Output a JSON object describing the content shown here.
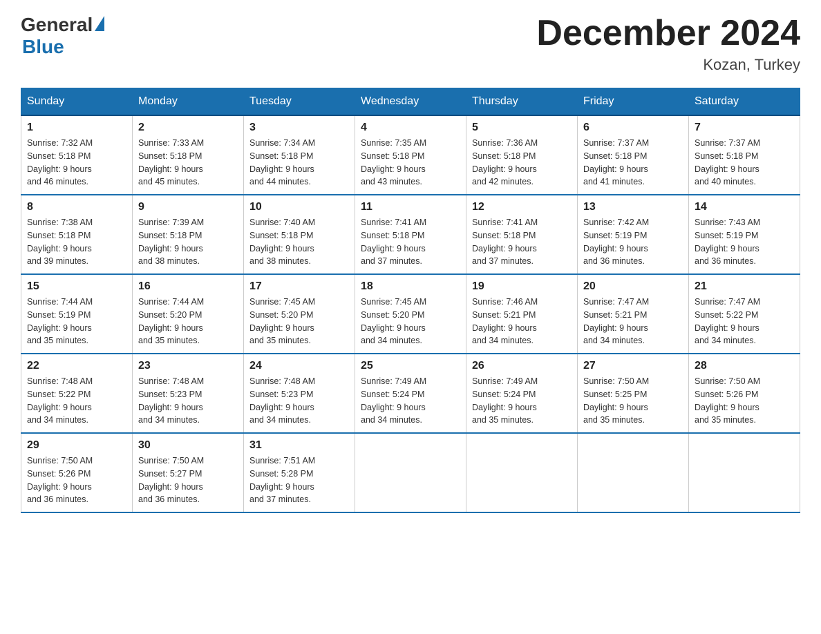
{
  "logo": {
    "general": "General",
    "blue": "Blue"
  },
  "title": {
    "month_year": "December 2024",
    "location": "Kozan, Turkey"
  },
  "days_of_week": [
    "Sunday",
    "Monday",
    "Tuesday",
    "Wednesday",
    "Thursday",
    "Friday",
    "Saturday"
  ],
  "weeks": [
    [
      {
        "day": "1",
        "sunrise": "7:32 AM",
        "sunset": "5:18 PM",
        "daylight": "9 hours and 46 minutes."
      },
      {
        "day": "2",
        "sunrise": "7:33 AM",
        "sunset": "5:18 PM",
        "daylight": "9 hours and 45 minutes."
      },
      {
        "day": "3",
        "sunrise": "7:34 AM",
        "sunset": "5:18 PM",
        "daylight": "9 hours and 44 minutes."
      },
      {
        "day": "4",
        "sunrise": "7:35 AM",
        "sunset": "5:18 PM",
        "daylight": "9 hours and 43 minutes."
      },
      {
        "day": "5",
        "sunrise": "7:36 AM",
        "sunset": "5:18 PM",
        "daylight": "9 hours and 42 minutes."
      },
      {
        "day": "6",
        "sunrise": "7:37 AM",
        "sunset": "5:18 PM",
        "daylight": "9 hours and 41 minutes."
      },
      {
        "day": "7",
        "sunrise": "7:37 AM",
        "sunset": "5:18 PM",
        "daylight": "9 hours and 40 minutes."
      }
    ],
    [
      {
        "day": "8",
        "sunrise": "7:38 AM",
        "sunset": "5:18 PM",
        "daylight": "9 hours and 39 minutes."
      },
      {
        "day": "9",
        "sunrise": "7:39 AM",
        "sunset": "5:18 PM",
        "daylight": "9 hours and 38 minutes."
      },
      {
        "day": "10",
        "sunrise": "7:40 AM",
        "sunset": "5:18 PM",
        "daylight": "9 hours and 38 minutes."
      },
      {
        "day": "11",
        "sunrise": "7:41 AM",
        "sunset": "5:18 PM",
        "daylight": "9 hours and 37 minutes."
      },
      {
        "day": "12",
        "sunrise": "7:41 AM",
        "sunset": "5:18 PM",
        "daylight": "9 hours and 37 minutes."
      },
      {
        "day": "13",
        "sunrise": "7:42 AM",
        "sunset": "5:19 PM",
        "daylight": "9 hours and 36 minutes."
      },
      {
        "day": "14",
        "sunrise": "7:43 AM",
        "sunset": "5:19 PM",
        "daylight": "9 hours and 36 minutes."
      }
    ],
    [
      {
        "day": "15",
        "sunrise": "7:44 AM",
        "sunset": "5:19 PM",
        "daylight": "9 hours and 35 minutes."
      },
      {
        "day": "16",
        "sunrise": "7:44 AM",
        "sunset": "5:20 PM",
        "daylight": "9 hours and 35 minutes."
      },
      {
        "day": "17",
        "sunrise": "7:45 AM",
        "sunset": "5:20 PM",
        "daylight": "9 hours and 35 minutes."
      },
      {
        "day": "18",
        "sunrise": "7:45 AM",
        "sunset": "5:20 PM",
        "daylight": "9 hours and 34 minutes."
      },
      {
        "day": "19",
        "sunrise": "7:46 AM",
        "sunset": "5:21 PM",
        "daylight": "9 hours and 34 minutes."
      },
      {
        "day": "20",
        "sunrise": "7:47 AM",
        "sunset": "5:21 PM",
        "daylight": "9 hours and 34 minutes."
      },
      {
        "day": "21",
        "sunrise": "7:47 AM",
        "sunset": "5:22 PM",
        "daylight": "9 hours and 34 minutes."
      }
    ],
    [
      {
        "day": "22",
        "sunrise": "7:48 AM",
        "sunset": "5:22 PM",
        "daylight": "9 hours and 34 minutes."
      },
      {
        "day": "23",
        "sunrise": "7:48 AM",
        "sunset": "5:23 PM",
        "daylight": "9 hours and 34 minutes."
      },
      {
        "day": "24",
        "sunrise": "7:48 AM",
        "sunset": "5:23 PM",
        "daylight": "9 hours and 34 minutes."
      },
      {
        "day": "25",
        "sunrise": "7:49 AM",
        "sunset": "5:24 PM",
        "daylight": "9 hours and 34 minutes."
      },
      {
        "day": "26",
        "sunrise": "7:49 AM",
        "sunset": "5:24 PM",
        "daylight": "9 hours and 35 minutes."
      },
      {
        "day": "27",
        "sunrise": "7:50 AM",
        "sunset": "5:25 PM",
        "daylight": "9 hours and 35 minutes."
      },
      {
        "day": "28",
        "sunrise": "7:50 AM",
        "sunset": "5:26 PM",
        "daylight": "9 hours and 35 minutes."
      }
    ],
    [
      {
        "day": "29",
        "sunrise": "7:50 AM",
        "sunset": "5:26 PM",
        "daylight": "9 hours and 36 minutes."
      },
      {
        "day": "30",
        "sunrise": "7:50 AM",
        "sunset": "5:27 PM",
        "daylight": "9 hours and 36 minutes."
      },
      {
        "day": "31",
        "sunrise": "7:51 AM",
        "sunset": "5:28 PM",
        "daylight": "9 hours and 37 minutes."
      },
      null,
      null,
      null,
      null
    ]
  ],
  "labels": {
    "sunrise": "Sunrise:",
    "sunset": "Sunset:",
    "daylight": "Daylight:"
  }
}
